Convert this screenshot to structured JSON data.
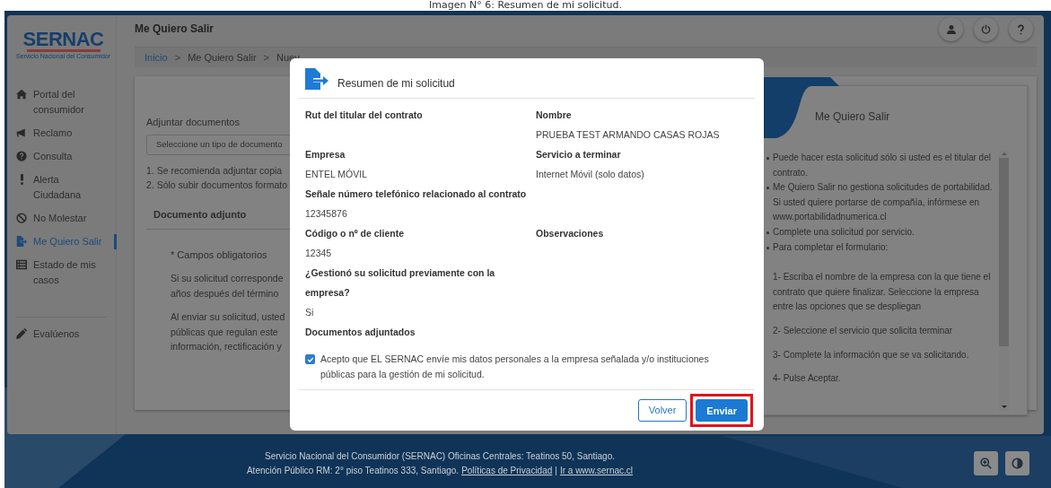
{
  "caption": "Imagen N° 6: Resumen de mi solicitud.",
  "sidebar": {
    "logo": {
      "title": "SERNAC",
      "subtitle": "Servicio Nacional del Consumidor"
    },
    "items": [
      {
        "label": "Portal del consumidor",
        "selected": false
      },
      {
        "label": "Reclamo",
        "selected": false
      },
      {
        "label": "Consulta",
        "selected": false
      },
      {
        "label": "Alerta Ciudadana",
        "selected": false
      },
      {
        "label": "No Molestar",
        "selected": false
      },
      {
        "label": "Me Quiero Salir",
        "selected": true
      },
      {
        "label": "Estado de mis casos",
        "selected": false
      }
    ],
    "bottom_items": [
      {
        "label": "Evalúenos",
        "selected": false
      }
    ]
  },
  "header": {
    "title": "Me Quiero Salir"
  },
  "breadcrumb": [
    {
      "kind": "link",
      "text": "Inicio"
    },
    {
      "kind": "sep",
      "text": ">"
    },
    {
      "kind": "text",
      "text": "Me Quiero Salir"
    },
    {
      "kind": "sep",
      "text": ">"
    },
    {
      "kind": "text",
      "text": "Nuev"
    }
  ],
  "form": {
    "label": "Adjuntar documentos",
    "select_placeholder": "Seleccione un tipo de documento",
    "notes": [
      "1. Se recomienda adjuntar copia",
      "2. Sólo subir documentos formato"
    ],
    "table_header": "Documento adjunto",
    "required_note": "* Campos obligatorios",
    "paragraphs": [
      "Si su solicitud corresponde\naños después del término",
      "Al enviar su solicitud, usted\npúblicas que regulan este\ninformación, rectificación y"
    ]
  },
  "side_card": {
    "title": "Me Quiero Salir",
    "bullets": [
      "Puede hacer esta solicitud sólo si usted es el titular del contrato.",
      "Me Quiero Salir no gestiona solicitudes de portabilidad. Si usted quiere portarse de compañía, infórmese en www.portabilidadnumerica.cl",
      "Complete una solicitud por servicio.",
      "Para completar el formulario:"
    ],
    "steps": [
      "1- Escriba el nombre de la empresa con la que tiene el contrato que quiere finalizar. Seleccione la empresa entre las opciones que se despliegan",
      "2- Seleccione el servicio que solicita terminar",
      "3- Complete la información que se va solicitando.",
      "4- Pulse Aceptar."
    ]
  },
  "modal": {
    "title": "Resumen de mi solicitud",
    "rows": [
      {
        "left": {
          "label": "Rut del titular del contrato"
        },
        "right": {
          "label": "Nombre",
          "value": "PRUEBA TEST ARMANDO CASAS ROJAS"
        }
      },
      {
        "left": {
          "label": "Empresa",
          "value": "ENTEL MÓVIL"
        },
        "right": {
          "label": "Servicio a terminar",
          "value": "Internet Móvil (solo datos)"
        }
      },
      {
        "left": {
          "label": "Señale número telefónico relacionado al contrato",
          "value": "12345876"
        }
      },
      {
        "left": {
          "label": "Código o nº de cliente",
          "value": "12345"
        },
        "right": {
          "label": "Observaciones"
        }
      },
      {
        "left": {
          "label": "¿Gestionó su solicitud previamente con la empresa?",
          "value": "Si"
        }
      },
      {
        "left": {
          "label": "Documentos adjuntados"
        }
      }
    ],
    "consent": {
      "checked": true,
      "text": "Acepto que EL SERNAC envíe mis datos personales a la empresa señalada y/o instituciones públicas para la gestión de mi solicitud."
    },
    "buttons": [
      {
        "label": "Volver",
        "kind": "secondary",
        "highlighted": false
      },
      {
        "label": "Enviar",
        "kind": "primary",
        "highlighted": true
      }
    ]
  },
  "footer": {
    "lines": [
      [
        {
          "kind": "text",
          "text": "Servicio Nacional del Consumidor (SERNAC) Oficinas Centrales: Teatinos 50, Santiago."
        }
      ],
      [
        {
          "kind": "text",
          "text": "Atención Público RM: 2° piso Teatinos 333, Santiago."
        },
        {
          "kind": "link",
          "text": "Políticas de Privacidad"
        },
        {
          "kind": "text",
          "text": "|"
        },
        {
          "kind": "link",
          "text": "Ir a www.sernac.cl"
        }
      ]
    ]
  }
}
